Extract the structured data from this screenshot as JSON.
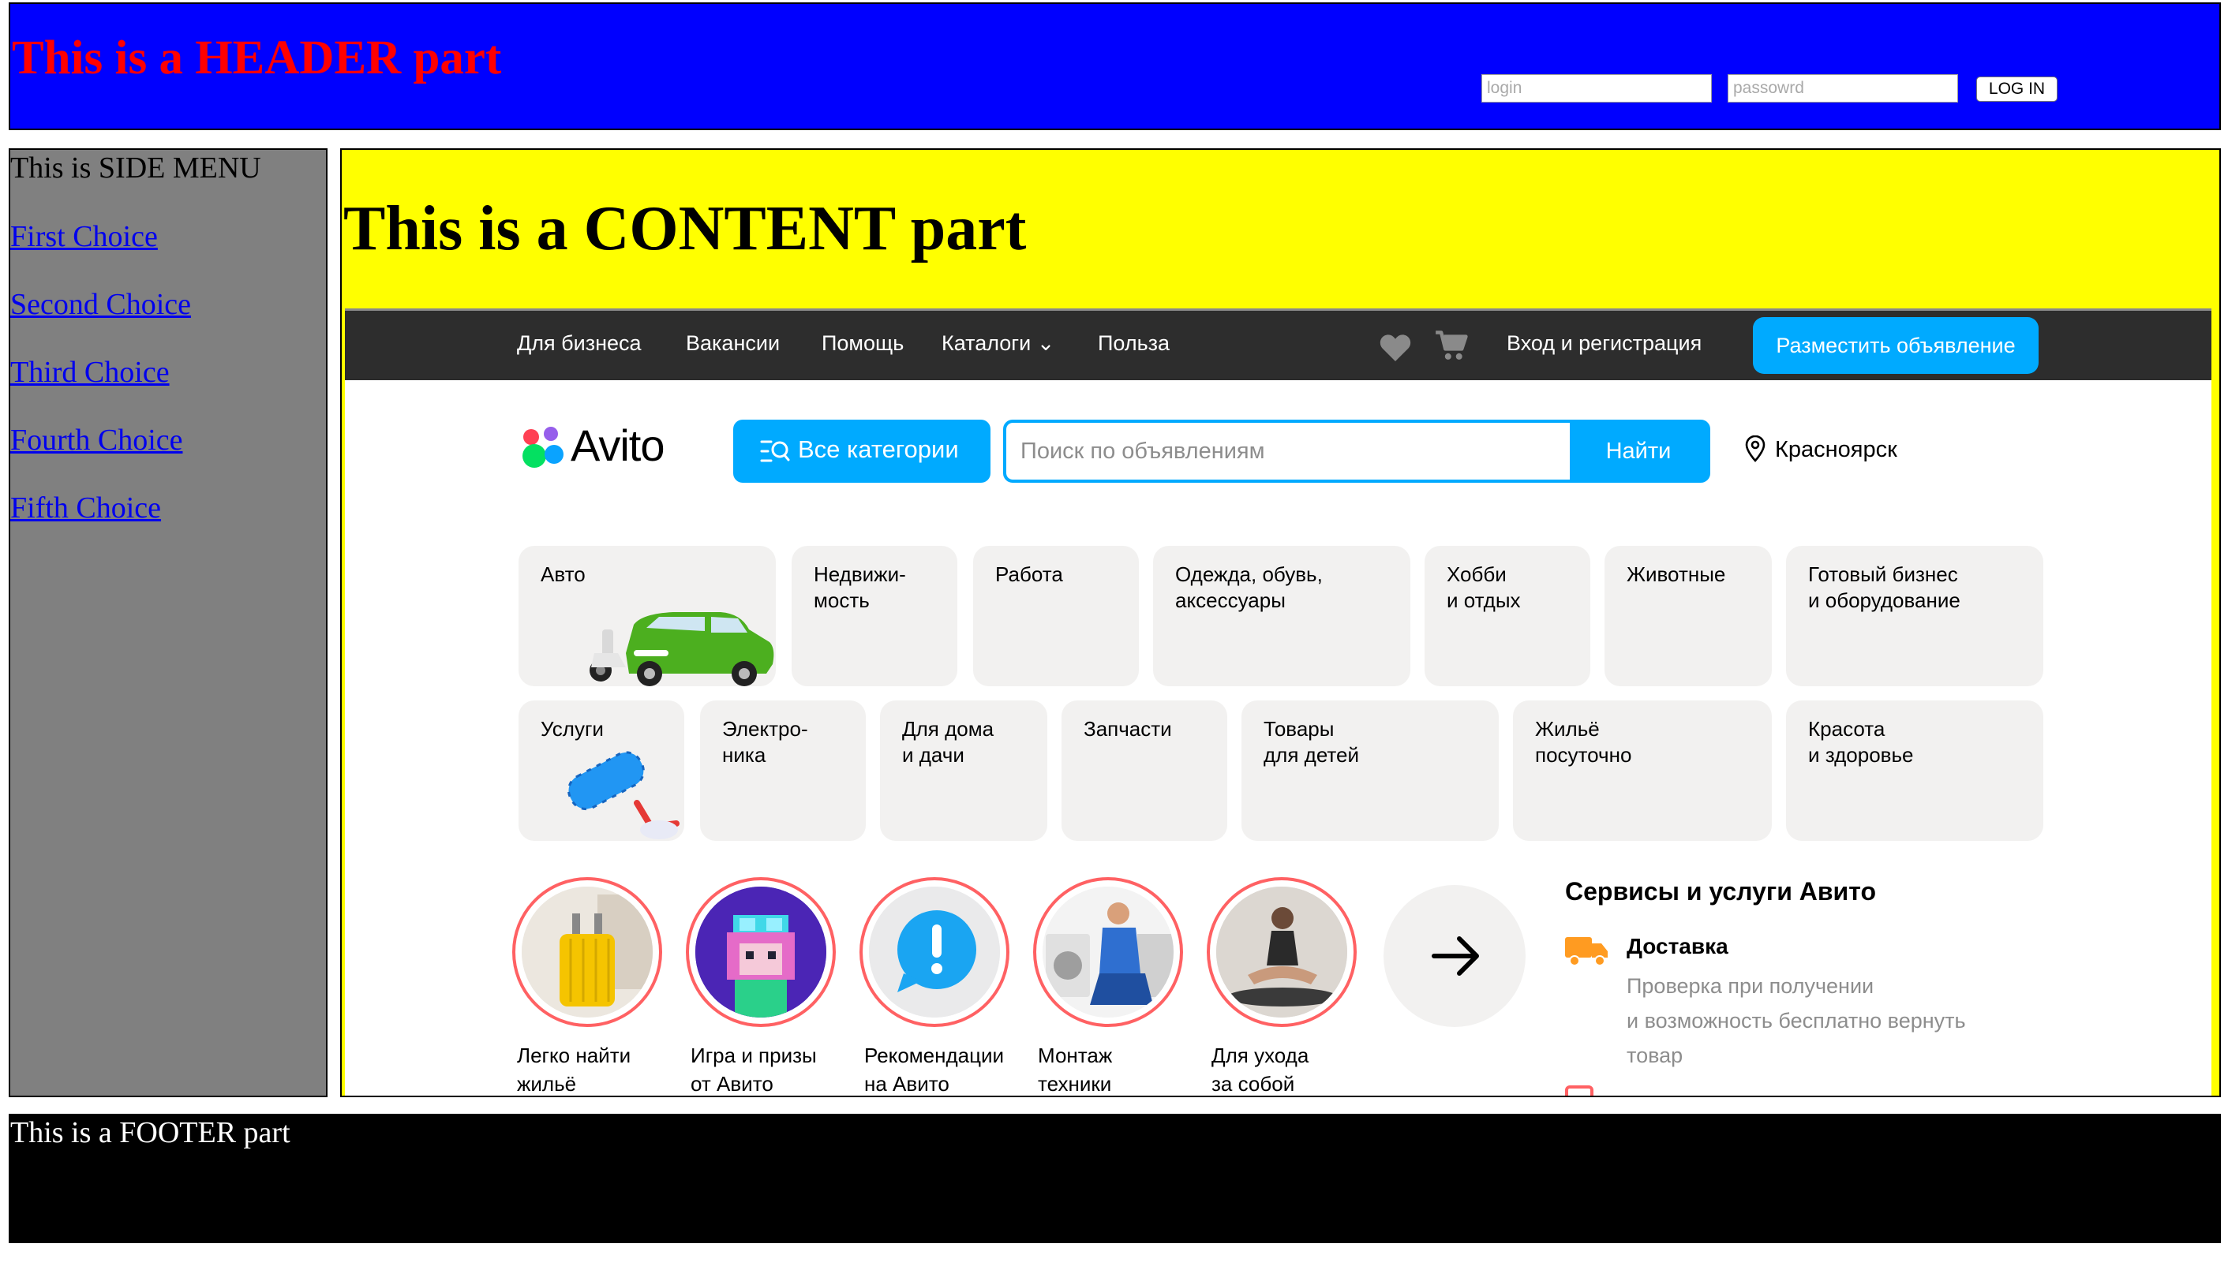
{
  "header": {
    "title": "This is a HEADER part",
    "login_placeholder": "login",
    "password_placeholder": "passowrd",
    "login_button": "LOG IN"
  },
  "sidemenu": {
    "title": "This is SIDE MENU",
    "links": [
      "First Choice",
      "Second Choice",
      "Third Choice",
      "Fourth Choice",
      "Fifth Choice"
    ]
  },
  "content": {
    "title": "This is a CONTENT part"
  },
  "avito": {
    "topbar": {
      "links": [
        "Для бизнеса",
        "Вакансии",
        "Помощь",
        "Каталоги",
        "Польза"
      ],
      "catalogs_chevron": "⌄",
      "login_link": "Вход и регистрация",
      "post_button": "Разместить объявление"
    },
    "logo_text": "Avito",
    "all_categories_button": "Все категории",
    "search_placeholder": "Поиск по объявлениям",
    "find_button": "Найти",
    "location": "Красноярск",
    "categories": [
      "Авто",
      "Недвижи-\nмость",
      "Работа",
      "Одежда, обувь,\nаксессуары",
      "Хобби\nи отдых",
      "Животные",
      "Готовый бизнес\nи оборудование",
      "Услуги",
      "Электро-\nника",
      "Для дома\nи дачи",
      "Запчасти",
      "Товары\nдля детей",
      "Жильё\nпосуточно",
      "Красота\nи здоровье"
    ],
    "stories": [
      "Легко найти\nжильё",
      "Игра и призы\nот Авито",
      "Рекомендации\nна Авито",
      "Монтаж\nтехники",
      "Для ухода\nза собой"
    ],
    "services": {
      "title": "Сервисы и услуги Авито",
      "delivery_title": "Доставка",
      "delivery_desc": "Проверка при получении\nи возможность бесплатно вернуть\nтовар"
    },
    "colors": {
      "accent": "#00aaff",
      "topbar": "#2d2d2d",
      "tile": "#f2f1f0",
      "story_ring": "#ff6163"
    }
  },
  "footer": {
    "text": "This is a FOOTER part"
  },
  "colors": {
    "header_bg": "#0000ff",
    "header_text": "#ff0000",
    "sidemenu_bg": "#808080",
    "content_bg": "#ffff00",
    "footer_bg": "#000000"
  }
}
